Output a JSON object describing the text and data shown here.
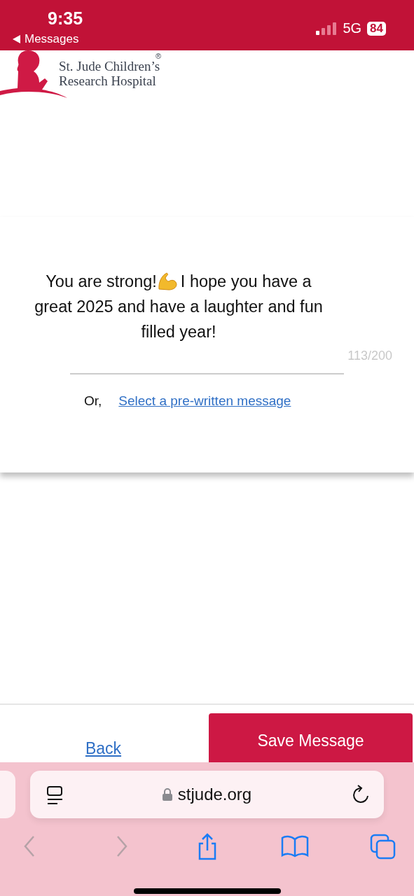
{
  "status_bar": {
    "time": "9:35",
    "back_label": "Messages",
    "network": "5G",
    "battery": "84"
  },
  "header": {
    "logo_line_1": "St. Jude Children’s",
    "logo_line_2": "Research Hospital",
    "registered_mark": "®"
  },
  "message": {
    "text_before": "You are strong!",
    "text_after": "I hope you have a great 2025 and have a laughter and fun filled year!",
    "counter": "113/200"
  },
  "alternative": {
    "prefix": "Or,",
    "link": "Select a pre-written message"
  },
  "actions": {
    "back": "Back",
    "save": "Save Message"
  },
  "browser": {
    "url": "stjude.org",
    "back_disabled": true,
    "forward_disabled": true
  }
}
